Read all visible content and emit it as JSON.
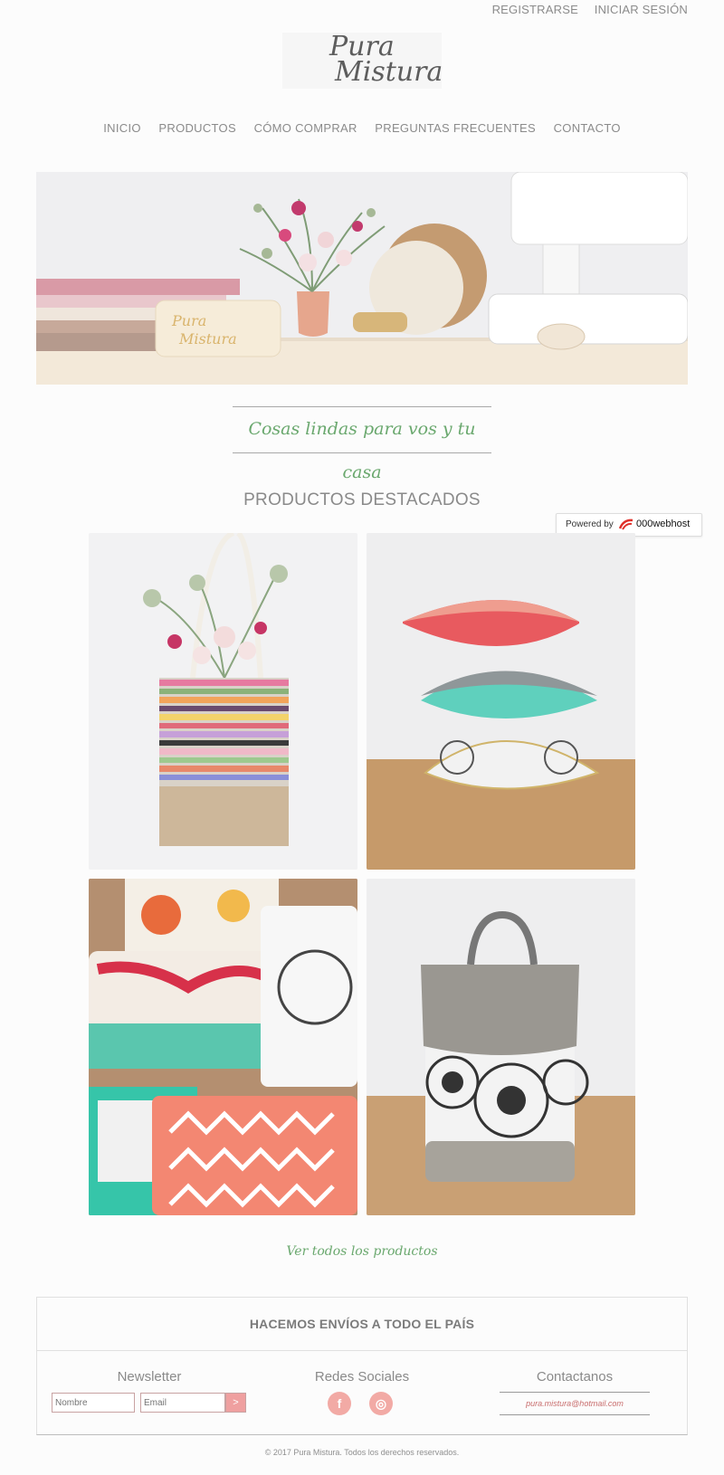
{
  "top_links": {
    "register": "REGISTRARSE",
    "login": "INICIAR SESIÓN"
  },
  "logo": {
    "line1": "Pura",
    "line2": "Mistura"
  },
  "nav": [
    {
      "label": "INICIO"
    },
    {
      "label": "PRODUCTOS"
    },
    {
      "label": "CÓMO COMPRAR"
    },
    {
      "label": "PREGUNTAS FRECUENTES"
    },
    {
      "label": "CONTACTO"
    }
  ],
  "hero": {
    "pillow_text_1": "Pura",
    "pillow_text_2": "Mistura"
  },
  "tagline": "Cosas lindas para vos y tu casa",
  "featured": {
    "title": "PRODUCTOS DESTACADOS",
    "see_all": "Ver todos los productos"
  },
  "powered": {
    "label": "Powered by",
    "brand": "000webhost"
  },
  "shipping": "HACEMOS ENVÍOS A TODO EL PAÍS",
  "footer": {
    "newsletter": {
      "title": "Newsletter",
      "name_placeholder": "Nombre",
      "email_placeholder": "Email",
      "submit": ">"
    },
    "social": {
      "title": "Redes Sociales",
      "facebook": "f",
      "instagram": "◎"
    },
    "contact": {
      "title": "Contactanos",
      "email": "pura.mistura@hotmail.com"
    }
  },
  "copyright": "© 2017 Pura Mistura. Todos los derechos reservados.",
  "colors": {
    "accent_green": "#6aa86e",
    "accent_pink": "#efa0a0",
    "text_gray": "#8b8b8b"
  }
}
